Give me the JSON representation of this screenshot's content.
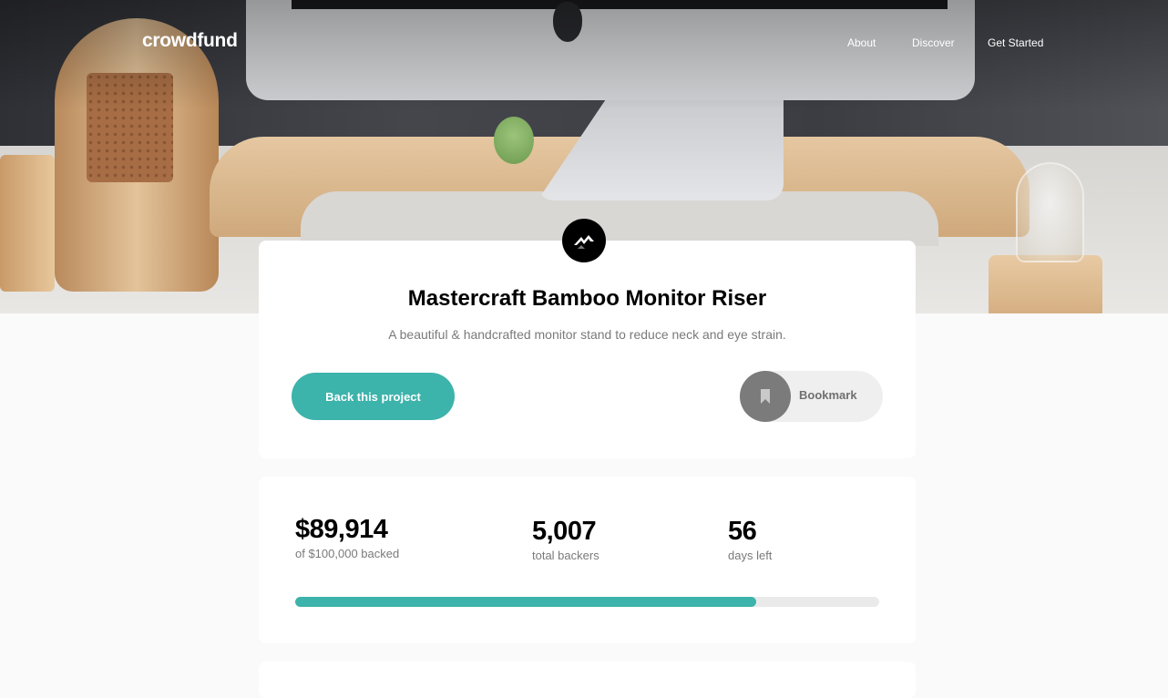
{
  "header": {
    "logo": "crowdfund",
    "nav": [
      "About",
      "Discover",
      "Get Started"
    ]
  },
  "project": {
    "title": "Mastercraft Bamboo Monitor Riser",
    "description": "A beautiful & handcrafted monitor stand to reduce neck and eye strain.",
    "back_button": "Back this project",
    "bookmark_label": "Bookmark",
    "logo_icon": "mastercraft-logo-icon"
  },
  "stats": {
    "backed_amount": "$89,914",
    "backed_label": "of $100,000 backed",
    "backers_count": "5,007",
    "backers_label": "total backers",
    "days_left": "56",
    "days_label": "days left",
    "progress_fraction": 0.79
  },
  "colors": {
    "accent": "#3cb3ab",
    "dark": "#000000",
    "muted_text": "#7a7a7a"
  }
}
